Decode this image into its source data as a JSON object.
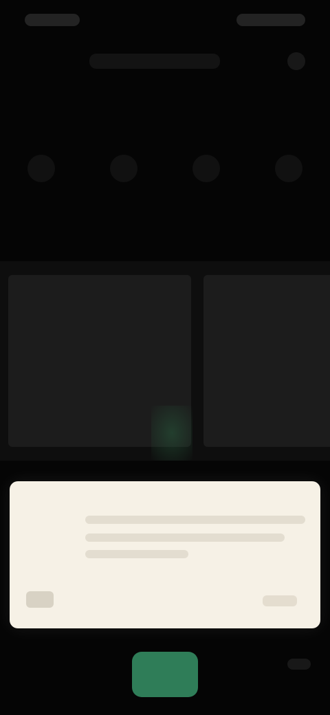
{
  "colors": {
    "background": "#050505",
    "dialog": "#f6f1e6",
    "accent": "#2f7d58"
  },
  "icons": {
    "status_left": "status-icons",
    "status_right": "system-indicators",
    "toolbar_right": "more-options-icon",
    "mode_1": "mode-icon",
    "mode_2": "mode-icon",
    "mode_3": "mode-icon",
    "mode_4": "mode-icon",
    "dialog_left": "dialog-icon",
    "bottom_right": "menu-icon"
  }
}
